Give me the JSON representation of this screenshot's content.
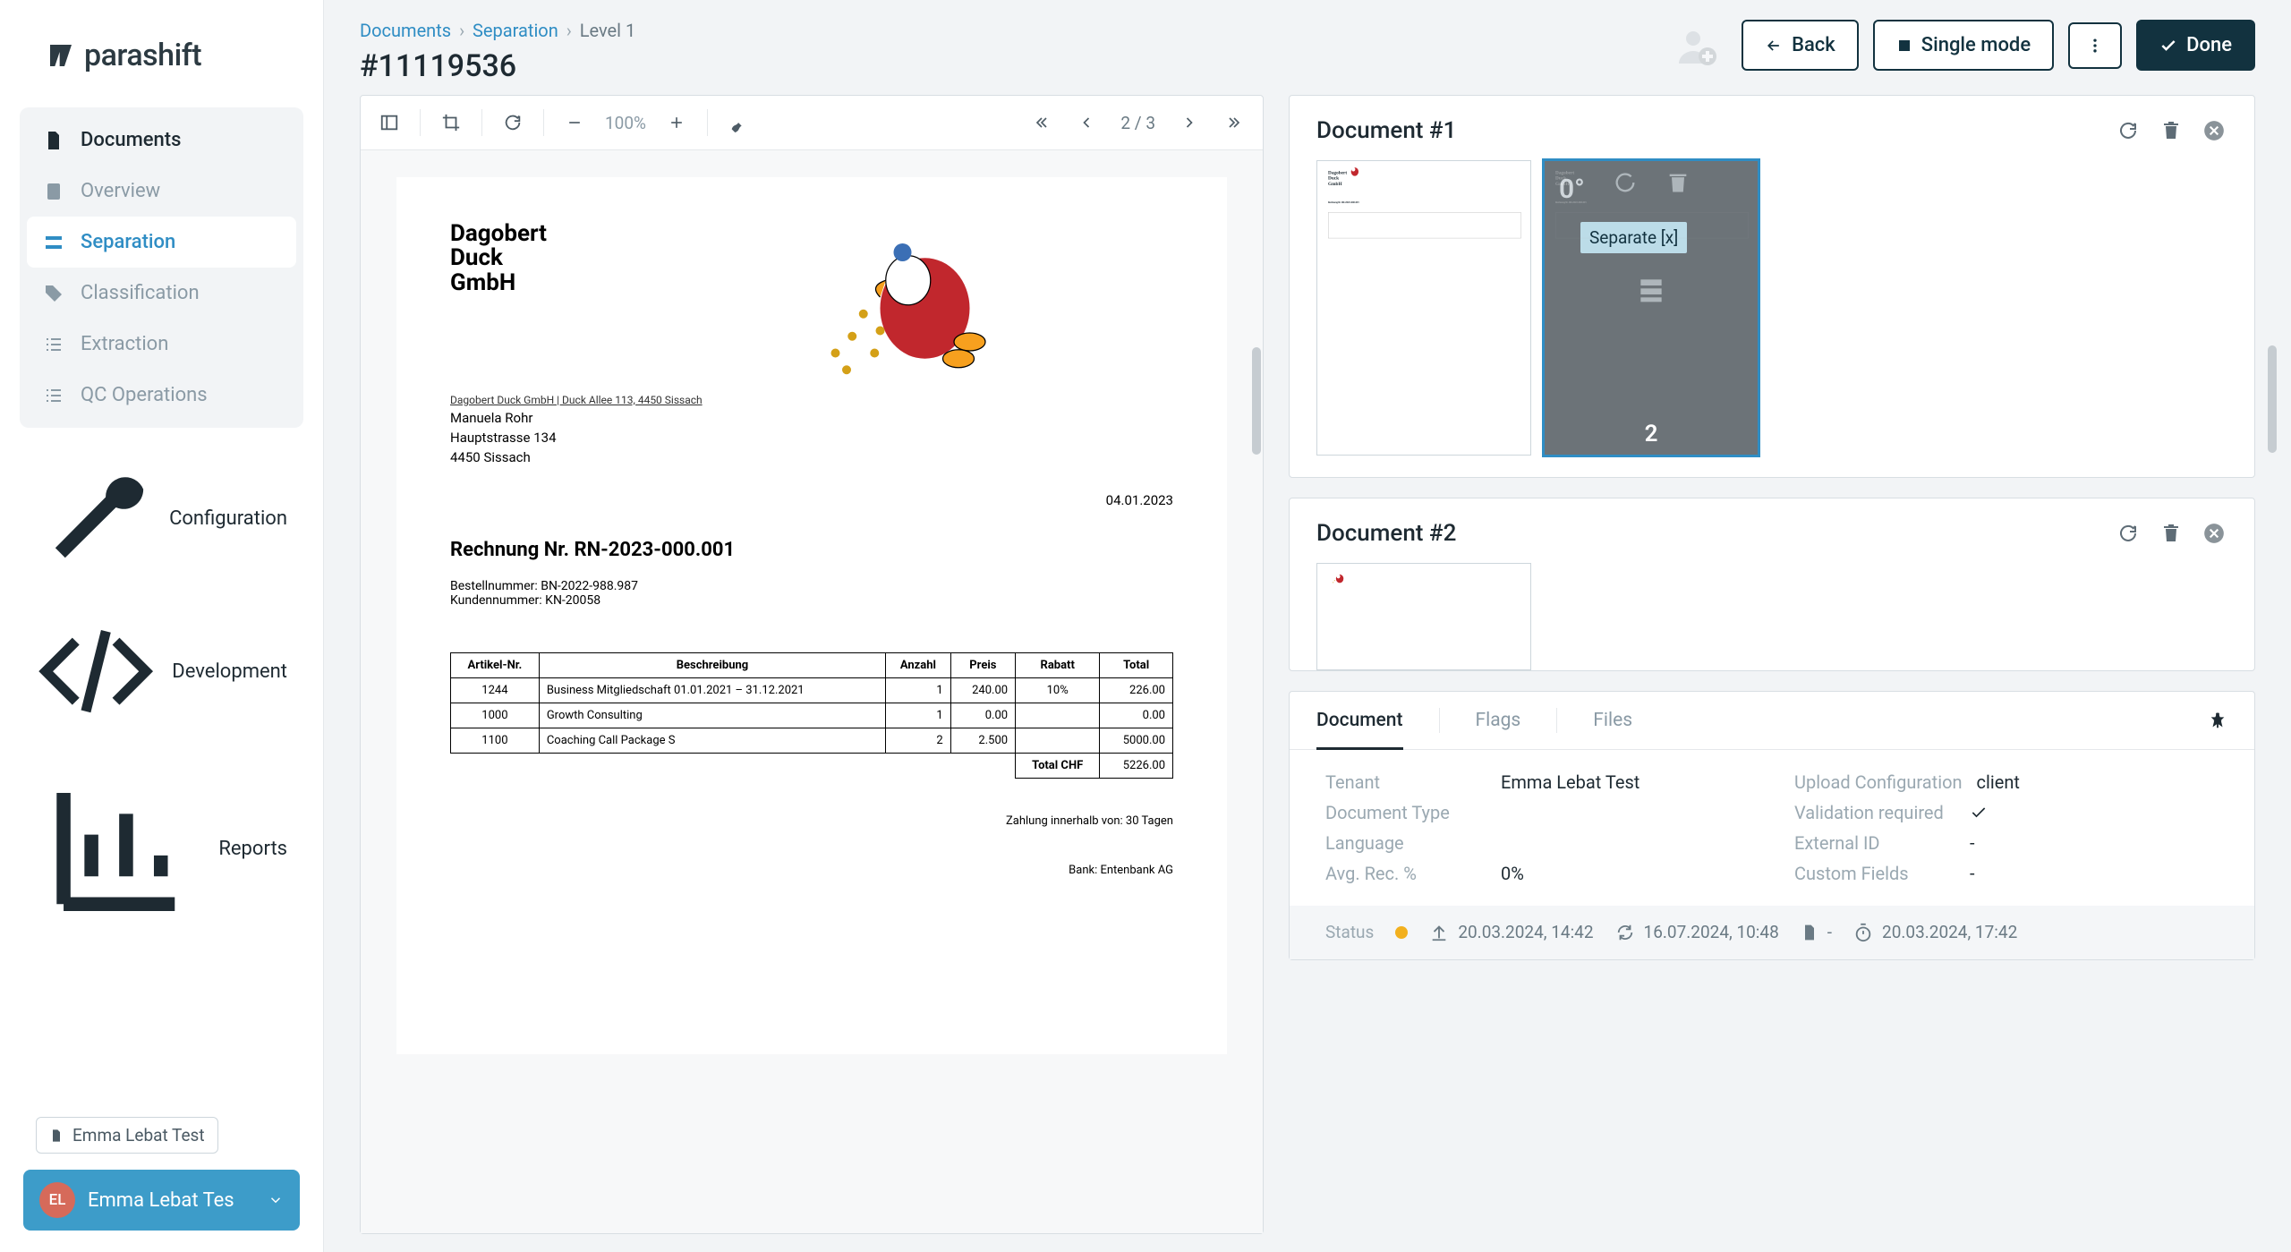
{
  "brand": "parashift",
  "sidebar": {
    "documents": "Documents",
    "items": [
      "Overview",
      "Separation",
      "Classification",
      "Extraction",
      "QC Operations"
    ],
    "configuration": "Configuration",
    "development": "Development",
    "reports": "Reports"
  },
  "tenant_chip": "Emma Lebat Test",
  "user": {
    "initials": "EL",
    "name": "Emma Lebat Tes"
  },
  "breadcrumb": {
    "a": "Documents",
    "b": "Separation",
    "c": "Level 1"
  },
  "page_title": "#11119536",
  "actions": {
    "back": "Back",
    "single": "Single mode",
    "done": "Done"
  },
  "viewer": {
    "zoom": "100%",
    "page_indicator": "2 / 3"
  },
  "invoice": {
    "company": [
      "Dagobert",
      "Duck",
      "GmbH"
    ],
    "sender": "Dagobert Duck GmbH | Duck Allee 113, 4450 Sissach",
    "recipient": [
      "Manuela Rohr",
      "Hauptstrasse 134",
      "4450 Sissach"
    ],
    "date": "04.01.2023",
    "title": "Rechnung Nr. RN-2023-000.001",
    "order": "Bestellnummer: BN-2022-988.987",
    "customer": "Kundennummer: KN-20058",
    "headers": [
      "Artikel-Nr.",
      "Beschreibung",
      "Anzahl",
      "Preis",
      "Rabatt",
      "Total"
    ],
    "rows": [
      {
        "nr": "1244",
        "desc": "Business Mitgliedschaft 01.01.2021 – 31.12.2021",
        "qty": "1",
        "price": "240.00",
        "discount": "10%",
        "total": "226.00"
      },
      {
        "nr": "1000",
        "desc": "Growth Consulting",
        "qty": "1",
        "price": "0.00",
        "discount": "",
        "total": "0.00"
      },
      {
        "nr": "1100",
        "desc": "Coaching Call Package S",
        "qty": "2",
        "price": "2.500",
        "discount": "",
        "total": "5000.00"
      }
    ],
    "total_label": "Total CHF",
    "total": "5226.00",
    "payment": "Zahlung innerhalb von: 30 Tagen",
    "bank": "Bank: Entenbank AG"
  },
  "docs": {
    "d1": {
      "title": "Document #1",
      "rot": "0°",
      "separate": "Separate [x]",
      "page": "2"
    },
    "d2": {
      "title": "Document #2"
    }
  },
  "info_tabs": [
    "Document",
    "Flags",
    "Files"
  ],
  "info": {
    "tenant_l": "Tenant",
    "tenant_v": "Emma Lebat Test",
    "upload_l": "Upload Configuration",
    "upload_v": "client",
    "type_l": "Document Type",
    "type_v": "",
    "valid_l": "Validation required",
    "lang_l": "Language",
    "lang_v": "",
    "ext_l": "External ID",
    "ext_v": "-",
    "avg_l": "Avg. Rec. %",
    "avg_v": "0%",
    "custom_l": "Custom Fields",
    "custom_v": "-"
  },
  "status": {
    "label": "Status",
    "upload": "20.03.2024, 14:42",
    "refresh": "16.07.2024, 10:48",
    "doc": "-",
    "timer": "20.03.2024, 17:42"
  }
}
